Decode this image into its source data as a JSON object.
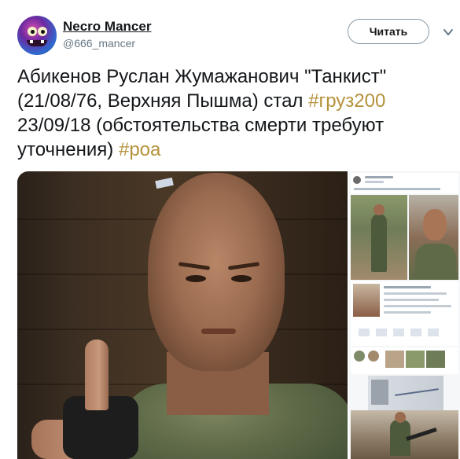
{
  "user": {
    "display_name": "Necro Mancer",
    "handle": "@666_mancer",
    "avatar_icon": "monster-avatar"
  },
  "follow_button": {
    "label": "Читать"
  },
  "menu_icon": "chevron-down-icon",
  "tweet": {
    "text_1": "Абикенов Руслан Жумажанович \"Танкист\" (21/08/76, Верхняя Пышма) стал ",
    "hashtag_1": "#груз200",
    "text_2": " 23/09/18 (обстоятельства смерти требуют уточнения) ",
    "hashtag_2": "#роа"
  },
  "colors": {
    "hashtag": "#b5923b",
    "text": "#14171a",
    "muted": "#657786",
    "button_border": "#8899a6"
  }
}
